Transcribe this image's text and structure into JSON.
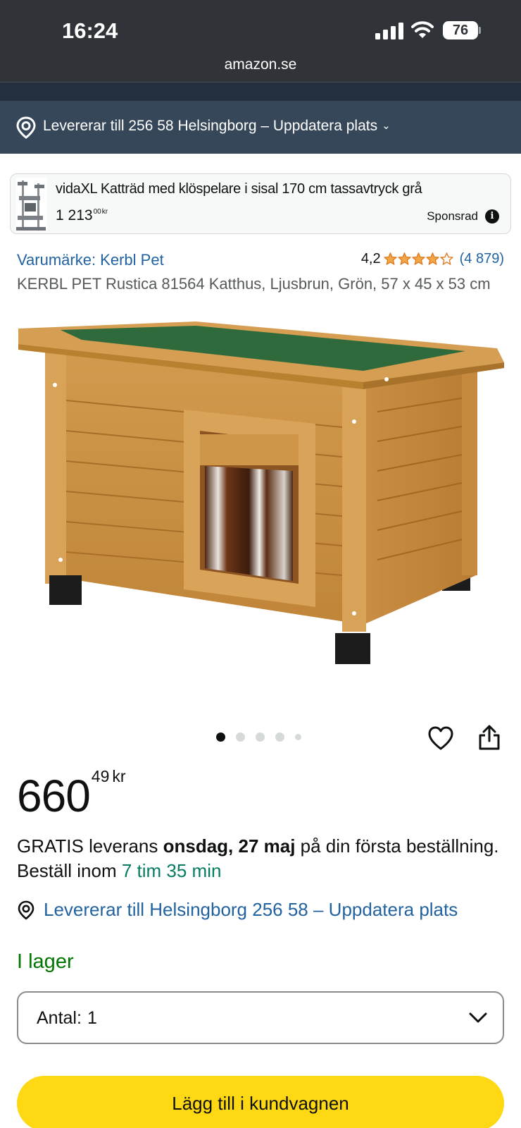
{
  "status_bar": {
    "time": "16:24",
    "battery": "76",
    "url": "amazon.se"
  },
  "location_bar": {
    "text": "Levererar till 256 58 Helsingborg – Uppdatera plats"
  },
  "sponsored_ad": {
    "title": "vidaXL Katträd med klöspelare i sisal 170 cm tassavtryck grå",
    "price_whole": "1 213",
    "price_fraction": "00",
    "price_currency": "kr",
    "sponsored_label": "Sponsrad"
  },
  "product": {
    "brand_link": "Varumärke: Kerbl Pet",
    "rating_value": "4,2",
    "rating_stars": 4.2,
    "review_count": "(4 879)",
    "title": "KERBL PET Rustica 81564 Katthus, Ljusbrun, Grön, 57 x 45 x 53 cm",
    "image_count": 5,
    "active_image": 1
  },
  "price": {
    "whole": "660",
    "fraction": "49",
    "currency": "kr"
  },
  "delivery": {
    "prefix": "GRATIS leverans ",
    "date": "onsdag, 27 maj",
    "middle": " på din första beställning. Beställ inom ",
    "countdown": "7 tim 35 min"
  },
  "deliver_to": "Levererar till Helsingborg 256 58 – Uppdatera plats",
  "stock": "I lager",
  "quantity": {
    "label": "Antal:",
    "value": "1"
  },
  "add_to_cart": "Lägg till i kundvagnen",
  "colors": {
    "link": "#2162a1",
    "star": "#f3a847",
    "in_stock": "#007600",
    "countdown": "#067d62",
    "cart_button": "#ffd814",
    "location_bar": "#37475a"
  },
  "icons": [
    "location-pin-icon",
    "info-icon",
    "star-icon",
    "heart-icon",
    "share-icon",
    "chevron-down-icon"
  ]
}
